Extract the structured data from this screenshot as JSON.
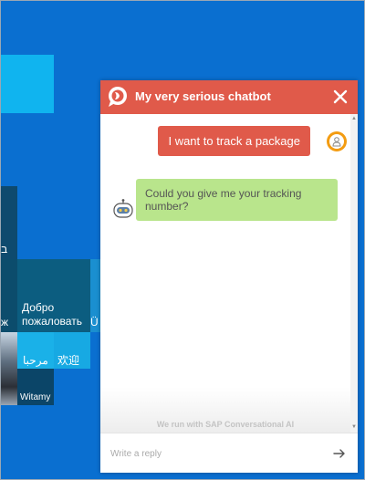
{
  "background": {
    "tiles": {
      "rtl_fragment": "ב",
      "welcome_ru": "Добро\nпожаловать",
      "welcome_fragment": "Ü",
      "arabic": "مرحبا",
      "chinese": "欢迎",
      "witamy": "Witamy"
    }
  },
  "chat": {
    "title": "My very serious chatbot",
    "colors": {
      "accent": "#e05a4a",
      "bot_bubble": "#b9e58c"
    },
    "messages": [
      {
        "from": "user",
        "text": "I want to track a package"
      },
      {
        "from": "bot",
        "text": "Could you give me your tracking number?"
      }
    ],
    "powered_by": "We run with SAP Conversational AI",
    "input": {
      "placeholder": "Write a reply",
      "value": ""
    },
    "icons": {
      "logo": "chat-bubble-logo-icon",
      "close": "close-icon",
      "user_avatar": "user-avatar-icon",
      "bot_avatar": "robot-icon",
      "send": "send-arrow-icon"
    }
  }
}
